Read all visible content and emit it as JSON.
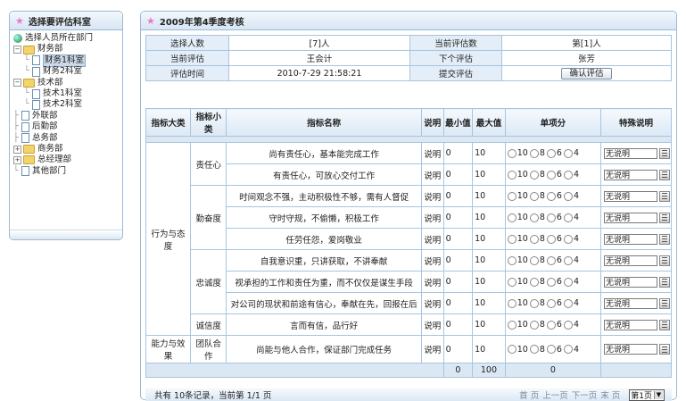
{
  "left_panel": {
    "title": "选择要评估科室",
    "tree": {
      "root": "选择人员所在部门",
      "departments": [
        {
          "name": "财务部",
          "expanded": true,
          "children": [
            "财务1科室",
            "财务2科室"
          ],
          "selected_child": 0
        },
        {
          "name": "技术部",
          "expanded": true,
          "children": [
            "技术1科室",
            "技术2科室"
          ]
        },
        {
          "name": "外联部"
        },
        {
          "name": "后勤部"
        },
        {
          "name": "总务部"
        },
        {
          "name": "商务部",
          "collapsed": true
        },
        {
          "name": "总经理部",
          "collapsed": true
        },
        {
          "name": "其他部门"
        }
      ]
    }
  },
  "right_panel": {
    "title": "2009年第4季度考核",
    "info": {
      "select_count_label": "选择人数",
      "select_count_value": "[7]人",
      "current_index_label": "当前评估数",
      "current_index_value": "第[1]人",
      "current_label": "当前评估",
      "current_value": "王会计",
      "next_label": "下个评估",
      "next_value": "张芳",
      "time_label": "评估时间",
      "time_value": "2010-7-29 21:58:21",
      "submit_label": "提交评估",
      "confirm_button": "确认评估"
    },
    "grid": {
      "headers": [
        "指标大类",
        "指标小类",
        "指标名称",
        "说明",
        "最小值",
        "最大值",
        "单项分",
        "特殊说明"
      ],
      "score_options": [
        "10",
        "8",
        "6",
        "4"
      ],
      "special_default": "无说明",
      "explain_text": "说明",
      "rows": [
        {
          "cat": "行为与态度",
          "sub": "责任心",
          "name": "尚有责任心，基本能完成工作",
          "min": "0",
          "max": "10"
        },
        {
          "name": "有责任心，可放心交付工作",
          "min": "0",
          "max": "10"
        },
        {
          "sub": "勤奋度",
          "name": "时间观念不强，主动积极性不够，需有人督促",
          "min": "0",
          "max": "10"
        },
        {
          "name": "守时守规，不偷懒，积极工作",
          "min": "0",
          "max": "10"
        },
        {
          "name": "任劳任怨，爱岗敬业",
          "min": "0",
          "max": "10"
        },
        {
          "sub": "忠诚度",
          "name": "自我意识重，只讲获取，不讲奉献",
          "min": "0",
          "max": "10"
        },
        {
          "name": "视承担的工作和责任为重，而不仅仅是谋生手段",
          "min": "0",
          "max": "10"
        },
        {
          "name": "对公司的现状和前途有信心，奉献在先，回报在后",
          "min": "0",
          "max": "10"
        },
        {
          "sub": "诚信度",
          "name": "言而有信，品行好",
          "min": "0",
          "max": "10"
        },
        {
          "cat": "能力与效果",
          "sub": "团队合作",
          "name": "尚能与他人合作，保证部门完成任务",
          "min": "0",
          "max": "10"
        }
      ],
      "totals": {
        "min": "0",
        "max": "100",
        "score": "0"
      }
    },
    "pager": {
      "summary": "共有 10条记录，当前第 1/1 页",
      "first": "首 页",
      "prev": "上一页",
      "next": "下一页",
      "last": "末 页",
      "page_select": "第1页"
    }
  }
}
